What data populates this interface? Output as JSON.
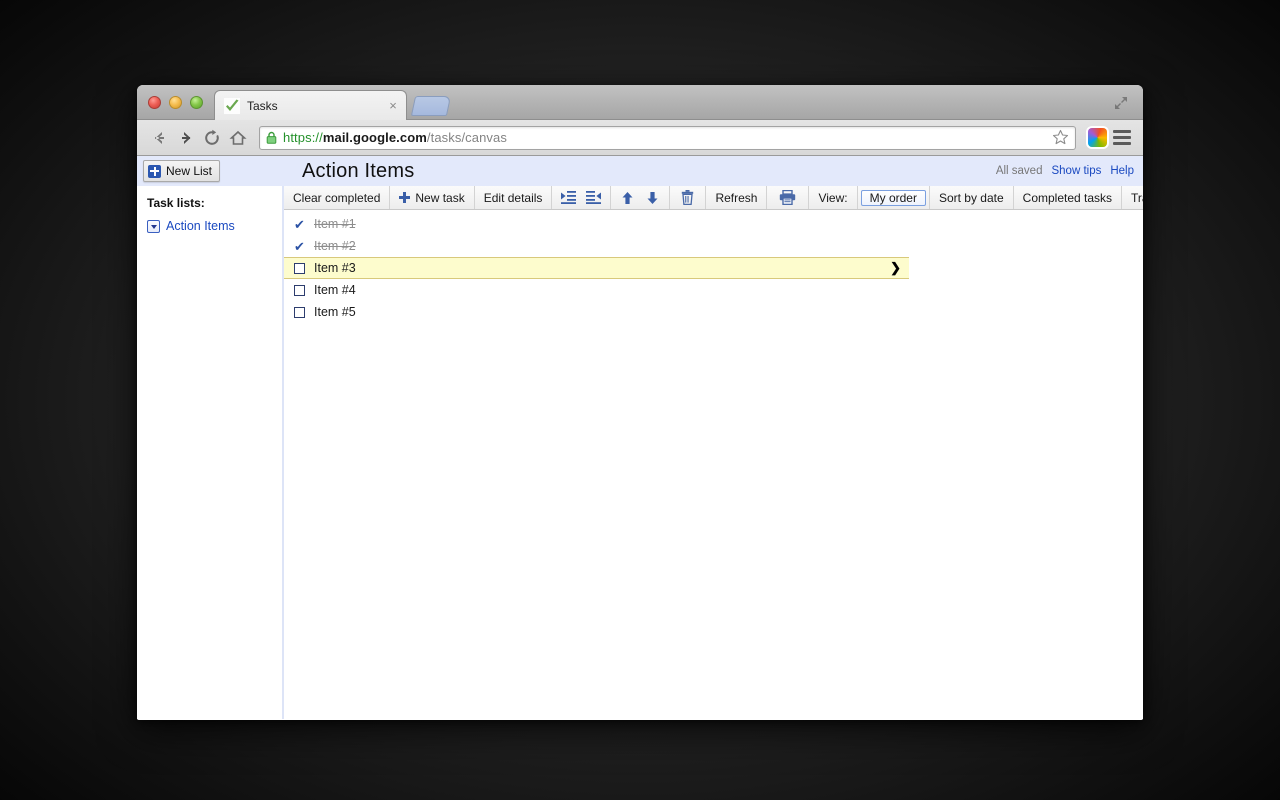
{
  "browser": {
    "tab": {
      "title": "Tasks",
      "favicon": "green-check-favicon",
      "close_label": "×"
    },
    "nav": {
      "back": "←",
      "forward": "→",
      "reload": "⟳",
      "home": "⌂"
    },
    "omnibox": {
      "scheme": "https",
      "separator": "://",
      "host": "mail.google.com",
      "path": "/tasks/canvas",
      "full_url": "https://mail.google.com/tasks/canvas",
      "secure_icon": "lock-icon",
      "bookmark_icon": "star-icon",
      "extension_icon": "cube-extension-icon",
      "menu_icon": "hamburger-menu-icon"
    },
    "window_controls": {
      "close": "close",
      "minimize": "minimize",
      "zoom": "zoom"
    },
    "maximize_icon": "fullscreen-arrows-icon"
  },
  "header": {
    "new_list_label": "New List",
    "list_title": "Action Items",
    "saved_status": "All saved",
    "show_tips": "Show tips",
    "help": "Help"
  },
  "sidebar": {
    "heading": "Task lists:",
    "items": [
      {
        "label": "Action Items",
        "caret_icon": "chevron-down-icon"
      }
    ]
  },
  "toolbar": {
    "clear_completed": "Clear completed",
    "new_task": "New task",
    "edit_details": "Edit details",
    "indent_icon": "indent-icon",
    "outdent_icon": "outdent-icon",
    "move_up_icon": "arrow-up-icon",
    "move_down_icon": "arrow-down-icon",
    "delete_icon": "trash-icon",
    "refresh": "Refresh",
    "print_icon": "printer-icon",
    "view_label": "View:",
    "my_order": "My order",
    "sort_by_date": "Sort by date",
    "completed_tasks": "Completed tasks",
    "trash": "Trash",
    "selected_view": "My order"
  },
  "tasks": [
    {
      "text": "Item #1",
      "done": true,
      "highlighted": false
    },
    {
      "text": "Item #2",
      "done": true,
      "highlighted": false
    },
    {
      "text": "Item #3",
      "done": false,
      "highlighted": true,
      "arrow": "❯"
    },
    {
      "text": "Item #4",
      "done": false,
      "highlighted": false
    },
    {
      "text": "Item #5",
      "done": false,
      "highlighted": false
    }
  ],
  "colors": {
    "header_bg": "#e3e9fb",
    "link_blue": "#1a49c0",
    "highlight_yellow": "#fdfccd",
    "check_blue": "#2b52a5",
    "secure_green": "#24912b"
  }
}
